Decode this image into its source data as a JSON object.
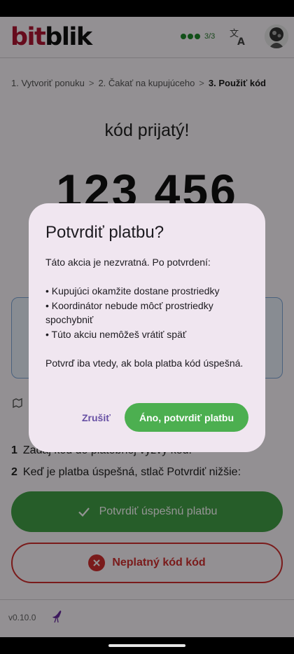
{
  "app": {
    "logo_bit": "bit",
    "logo_blik": "blik",
    "progress": "3/3"
  },
  "breadcrumb": {
    "step1": "1. Vytvoriť ponuku",
    "step2": "2. Čakať na kupujúceho",
    "step3": "3. Použiť kód",
    "separator": ">"
  },
  "main": {
    "received": "kód prijatý!",
    "code": "123 456"
  },
  "steps": {
    "step1_num": "1",
    "step1_text": "Zadaj kód do platobnej výzvy kód.",
    "step2_num": "2",
    "step2_text": "Keď je platba úspešná, stlač Potvrdiť nižšie:"
  },
  "buttons": {
    "confirm": "Potvrdiť úspešnú platbu",
    "invalid": "Neplatný kód kód"
  },
  "footer": {
    "version": "v0.10.0"
  },
  "dialog": {
    "title": "Potvrdiť platbu?",
    "intro": "Táto akcia je nezvratná. Po potvrdení:",
    "bullet1": "• Kupujúci okamžite dostane prostriedky",
    "bullet2": "• Koordinátor nebude môcť prostriedky spochybniť",
    "bullet3": "• Túto akciu nemôžeš vrátiť späť",
    "outro": "Potvrď iba vtedy, ak bola platba kód úspešná.",
    "cancel": "Zrušiť",
    "accept": "Áno, potvrdiť platbu"
  },
  "colors": {
    "brand_red": "#b01532",
    "success_green": "#43a047",
    "error_red": "#d32f2f",
    "dialog_bg": "#f0e6f0",
    "accent_purple": "#6750a4"
  },
  "icons": [
    "translate-icon",
    "avatar",
    "info-icon",
    "check-icon",
    "close-circle-icon",
    "ostrich-icon"
  ]
}
